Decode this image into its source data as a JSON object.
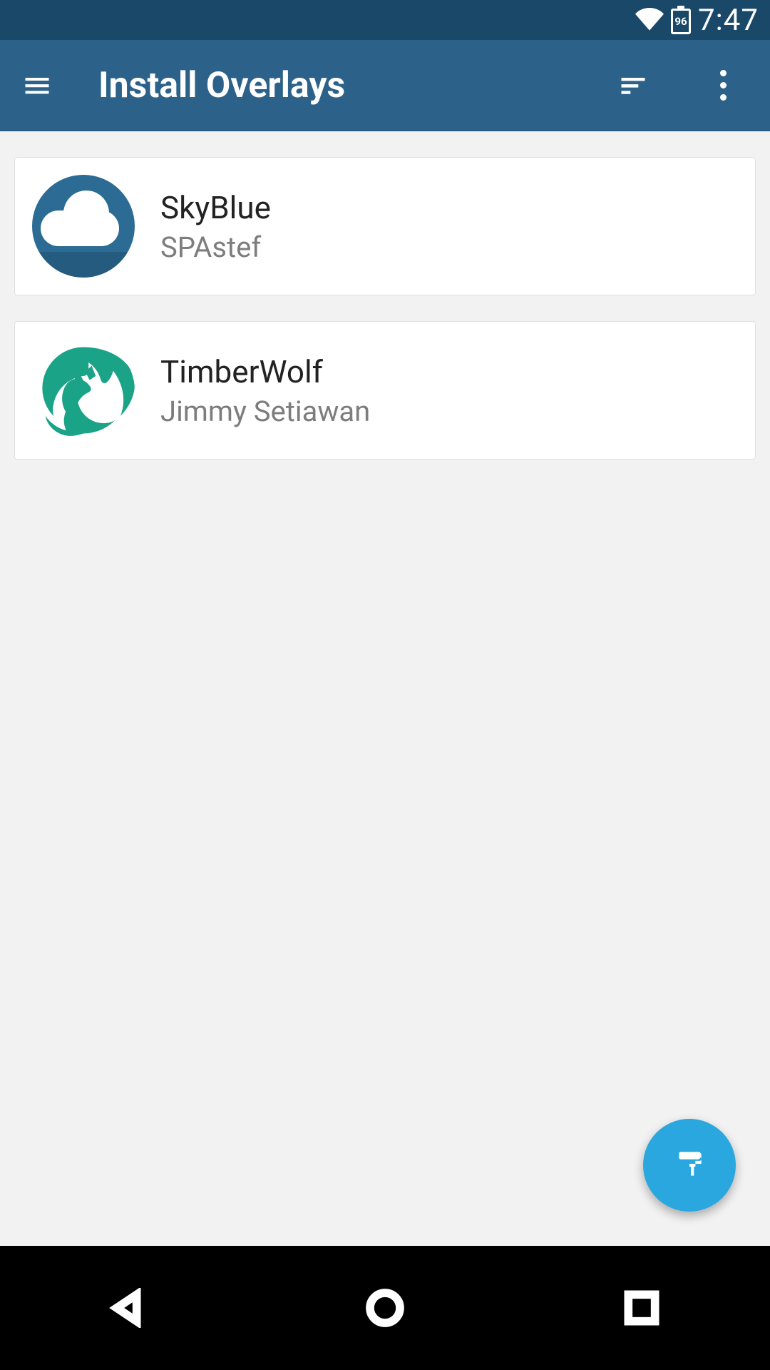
{
  "status": {
    "battery": "96",
    "time": "7:47"
  },
  "appbar": {
    "title": "Install Overlays"
  },
  "overlays": [
    {
      "name": "SkyBlue",
      "author": "SPAstef",
      "icon": "cloud",
      "icon_color": "#2b6b94"
    },
    {
      "name": "TimberWolf",
      "author": "Jimmy Setiawan",
      "icon": "wolf",
      "icon_color": "#1aa386"
    }
  ],
  "colors": {
    "status_bar": "#1a4869",
    "app_bar": "#2c6289",
    "fab": "#2aa7df",
    "background": "#f2f2f2"
  }
}
